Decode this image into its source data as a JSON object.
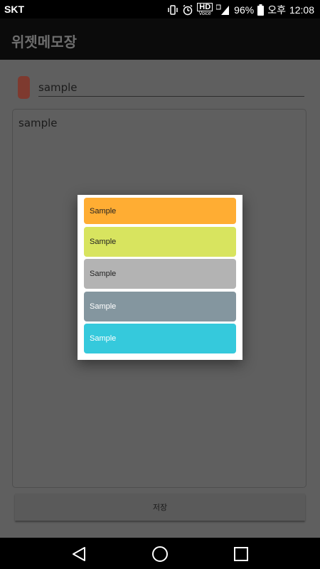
{
  "status_bar": {
    "carrier": "SKT",
    "hd_label": "HD",
    "voice_label": "Voice",
    "battery_percent": "96%",
    "time_prefix": "오후",
    "time": "12:08"
  },
  "app": {
    "title": "위젯메모장"
  },
  "editor": {
    "title_value": "sample",
    "body_value": "sample",
    "save_label": "저장",
    "color_chip": "#7e3a2f"
  },
  "dialog": {
    "options": [
      {
        "label": "Sample",
        "color": "#ffad33",
        "text_color": "#222222"
      },
      {
        "label": "Sample",
        "color": "#d8e45f",
        "text_color": "#222222"
      },
      {
        "label": "Sample",
        "color": "#b3b3b3",
        "text_color": "#222222"
      },
      {
        "label": "Sample",
        "color": "#84969f",
        "text_color": "#ffffff"
      },
      {
        "label": "Sample",
        "color": "#35c9dc",
        "text_color": "#ffffff"
      }
    ]
  }
}
